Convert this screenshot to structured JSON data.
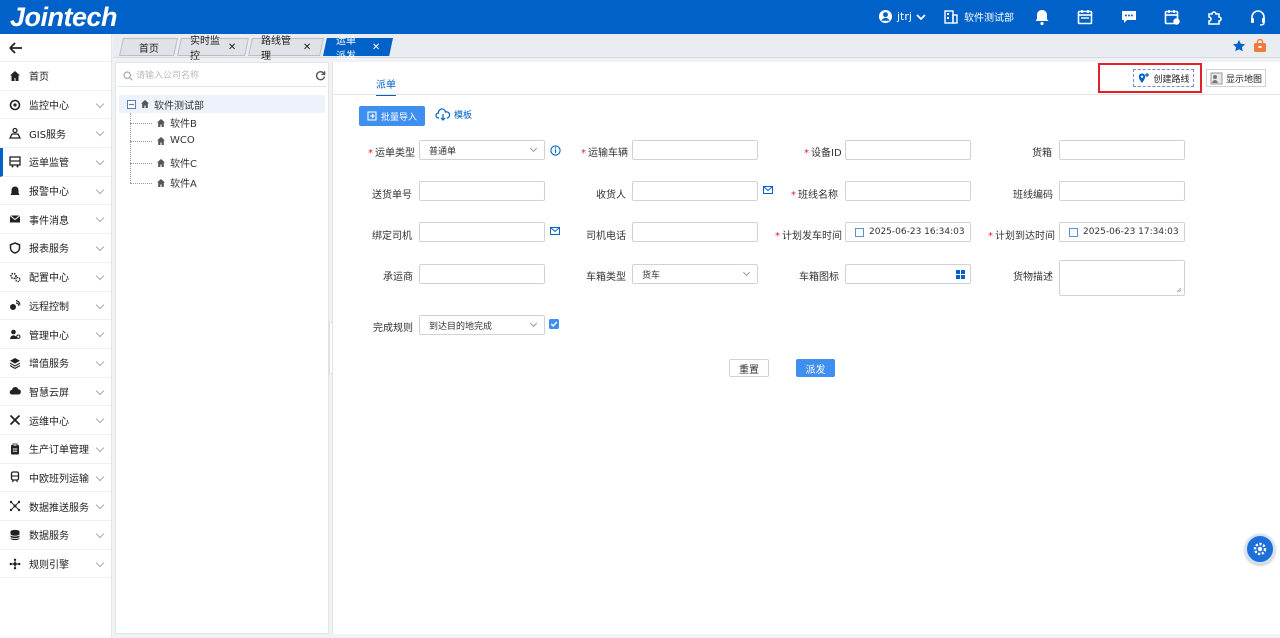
{
  "header": {
    "logo_text": "Jointech",
    "user_name": "jtrj",
    "org_name": "软件测试部",
    "icons": [
      "user-circle-icon",
      "building-icon",
      "bell-icon",
      "calendar-icon",
      "chat-icon",
      "schedule-icon",
      "puzzle-icon",
      "headset-icon"
    ]
  },
  "sidebar": {
    "back_icon": "arrow-left-icon",
    "items": [
      {
        "label": "首页",
        "icon": "home-icon"
      },
      {
        "label": "监控中心",
        "icon": "monitor-icon"
      },
      {
        "label": "GIS服务",
        "icon": "map-person-icon"
      },
      {
        "label": "运单监管",
        "icon": "truck-icon"
      },
      {
        "label": "报警中心",
        "icon": "alarm-icon"
      },
      {
        "label": "事件消息",
        "icon": "mail-icon"
      },
      {
        "label": "报表服务",
        "icon": "shield-icon"
      },
      {
        "label": "配置中心",
        "icon": "gears-icon"
      },
      {
        "label": "远程控制",
        "icon": "remote-icon"
      },
      {
        "label": "管理中心",
        "icon": "user-gear-icon"
      },
      {
        "label": "增值服务",
        "icon": "layers-icon"
      },
      {
        "label": "智慧云屏",
        "icon": "cloud-icon"
      },
      {
        "label": "运维中心",
        "icon": "tools-icon"
      },
      {
        "label": "生产订单管理",
        "icon": "clipboard-icon"
      },
      {
        "label": "中欧班列运输",
        "icon": "train-icon"
      },
      {
        "label": "数据推送服务",
        "icon": "nodes-icon"
      },
      {
        "label": "数据服务",
        "icon": "database-icon"
      },
      {
        "label": "规则引擎",
        "icon": "network-icon"
      }
    ]
  },
  "tabs": [
    {
      "label": "首页"
    },
    {
      "label": "实时监控"
    },
    {
      "label": "路线管理"
    },
    {
      "label": "运单派发"
    }
  ],
  "tree": {
    "search_placeholder": "请输入公司名称",
    "root": "软件测试部",
    "children": [
      "软件B",
      "WCO",
      "软件C",
      "软件A"
    ]
  },
  "main": {
    "subtab": "派单",
    "create_route": "创建路线",
    "show_map": "显示地图",
    "batch_import": "批量导入",
    "template": "模板",
    "fields": {
      "order_type": {
        "label": "运单类型",
        "value": "普通单"
      },
      "vehicle": {
        "label": "运输车辆",
        "value": ""
      },
      "device_id": {
        "label": "设备ID",
        "value": ""
      },
      "cargo_box": {
        "label": "货箱",
        "value": ""
      },
      "delivery_no": {
        "label": "送货单号",
        "value": ""
      },
      "receiver": {
        "label": "收货人",
        "value": ""
      },
      "line_name": {
        "label": "班线名称",
        "value": ""
      },
      "line_code": {
        "label": "班线编码",
        "value": ""
      },
      "driver": {
        "label": "绑定司机",
        "value": ""
      },
      "driver_phone": {
        "label": "司机电话",
        "value": ""
      },
      "plan_depart": {
        "label": "计划发车时间",
        "value": "2025-06-23 16:34:03"
      },
      "plan_arrive": {
        "label": "计划到达时间",
        "value": "2025-06-23 17:34:03"
      },
      "carrier": {
        "label": "承运商",
        "value": ""
      },
      "box_type": {
        "label": "车箱类型",
        "value": "货车"
      },
      "box_icon": {
        "label": "车箱图标",
        "value": ""
      },
      "cargo_desc": {
        "label": "货物描述",
        "value": ""
      },
      "finish_rule": {
        "label": "完成规则",
        "value": "到达目的地完成"
      }
    },
    "reset": "重置",
    "dispatch": "派发"
  },
  "colors": {
    "brand": "#0061c8",
    "button_primary": "#3e8ff0",
    "highlight": "#e0212b"
  }
}
